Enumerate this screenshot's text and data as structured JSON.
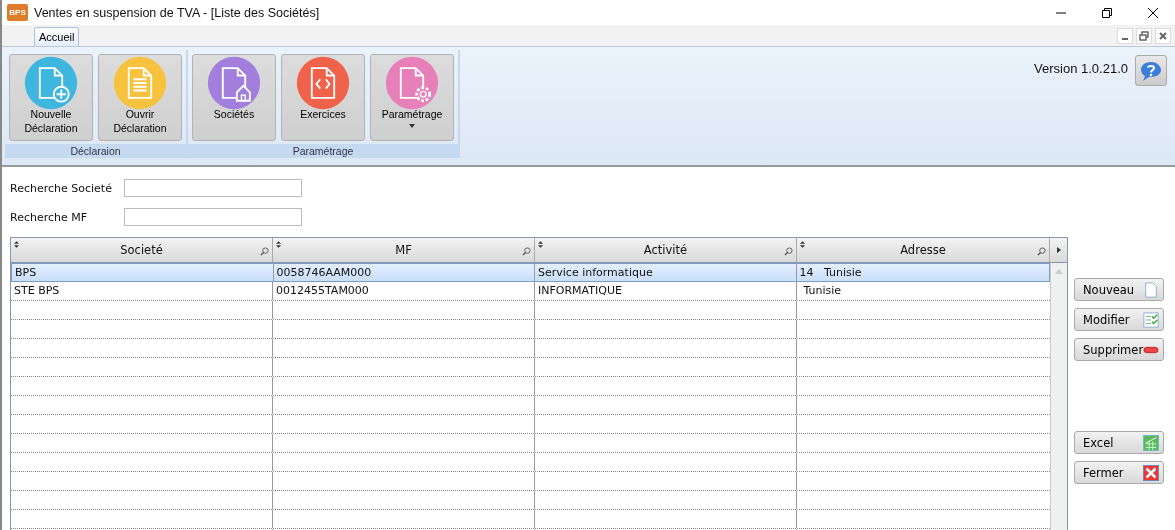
{
  "window": {
    "title": "Ventes en suspension de TVA - [Liste des Sociétés]",
    "app_badge": "BPS"
  },
  "tabs": [
    {
      "label": "Accueil",
      "selected": true
    }
  ],
  "ribbon": {
    "groups": [
      {
        "label": "Déclaraion",
        "buttons": [
          {
            "label": "Nouvelle Déclaration",
            "kind": "new",
            "dropdown": false
          },
          {
            "label": "Ouvrir Déclaration",
            "kind": "open",
            "dropdown": false
          }
        ]
      },
      {
        "label": "Paramétrage",
        "buttons": [
          {
            "label": "Sociétés",
            "kind": "company",
            "dropdown": false
          },
          {
            "label": "Exercices",
            "kind": "code",
            "dropdown": false
          },
          {
            "label": "Paramétrage",
            "kind": "settings",
            "dropdown": true
          }
        ]
      }
    ],
    "version": "Version 1.0.21.0"
  },
  "search": [
    {
      "label": "Recherche Societé"
    },
    {
      "label": "Recherche MF"
    }
  ],
  "table": {
    "columns": [
      "Societé",
      "MF",
      "Activité",
      "Adresse"
    ],
    "rows": [
      {
        "cells": [
          "BPS",
          "0058746AAM000",
          "Service informatique",
          "14   Tunisie"
        ],
        "selected": true
      },
      {
        "cells": [
          "STE BPS",
          "0012455TAM000",
          "INFORMATIQUE",
          " Tunisie"
        ],
        "selected": false
      }
    ]
  },
  "actions": [
    {
      "label": "Nouveau",
      "kind": "new"
    },
    {
      "label": "Modifier",
      "kind": "edit"
    },
    {
      "label": "Supprimer",
      "kind": "delete"
    },
    {
      "label": "Excel",
      "kind": "excel"
    },
    {
      "label": "Fermer",
      "kind": "close"
    }
  ]
}
